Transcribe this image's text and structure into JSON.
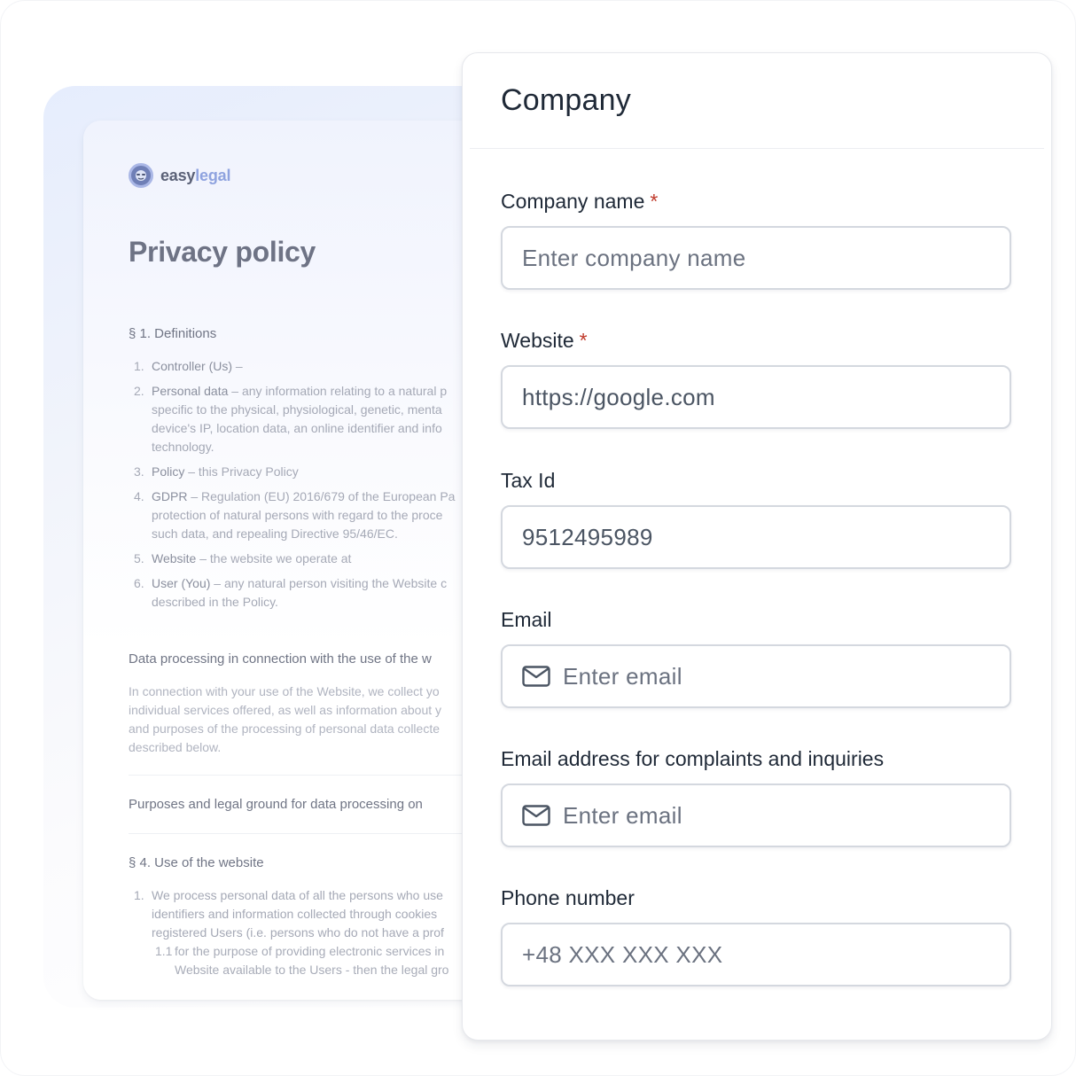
{
  "document": {
    "brand": {
      "primary": "easy",
      "accent": "legal"
    },
    "title": "Privacy policy",
    "section1_heading": "§ 1. Definitions",
    "definitions": [
      {
        "num": "1.",
        "term": "Controller (Us)",
        "text": " –"
      },
      {
        "num": "2.",
        "term": "Personal data",
        "text": " – any information relating to a natural p",
        "more": [
          "specific to the physical, physiological, genetic, menta",
          "device's IP, location data, an online identifier and info",
          "technology."
        ]
      },
      {
        "num": "3.",
        "term": "Policy",
        "text": " – this Privacy Policy"
      },
      {
        "num": "4.",
        "term": "GDPR",
        "text": " – Regulation (EU) 2016/679 of the European Pa",
        "more": [
          "protection of natural persons with regard to the proce",
          "such data, and repealing Directive 95/46/EC."
        ]
      },
      {
        "num": "5.",
        "term": "Website",
        "text": " – the website we operate at"
      },
      {
        "num": "6.",
        "term": "User (You)",
        "text": " – any natural person visiting the Website c",
        "more": [
          "described in the Policy."
        ]
      }
    ],
    "section2_heading": "Data processing in connection with the use of the w",
    "section2_lines": [
      "In connection with your use of the Website, we collect yo",
      "individual services offered, as well as information about y",
      "and purposes of the processing of personal data collecte",
      "described below."
    ],
    "section3_heading": "Purposes and legal ground for data processing on",
    "section4_heading": "§ 4. Use of the website",
    "section4_list": [
      {
        "num": "1.",
        "lines": [
          "We process personal data of all the persons who use",
          "identifiers and information collected through cookies",
          "registered Users (i.e. persons who do not have a prof"
        ]
      }
    ],
    "section4_sub": {
      "num": "1.1",
      "lines": [
        "for the purpose of providing electronic services in",
        "Website available to the Users - then the legal gro"
      ]
    }
  },
  "form": {
    "title": "Company",
    "required_mark": "*",
    "fields": {
      "company_name": {
        "label": "Company name",
        "placeholder": "Enter company name",
        "value": ""
      },
      "website": {
        "label": "Website",
        "value": "https://google.com"
      },
      "tax_id": {
        "label": "Tax Id",
        "value": "9512495989"
      },
      "email": {
        "label": "Email",
        "placeholder": "Enter email",
        "icon": "mail-icon"
      },
      "complaints_email": {
        "label": "Email address for complaints and inquiries",
        "placeholder": "Enter email",
        "icon": "mail-icon"
      },
      "phone": {
        "label": "Phone number",
        "placeholder": "+48 XXX XXX XXX"
      }
    }
  },
  "colors": {
    "required": "#c03a2b",
    "brand_accent": "#8fa3df",
    "input_border": "#d4d8df"
  }
}
